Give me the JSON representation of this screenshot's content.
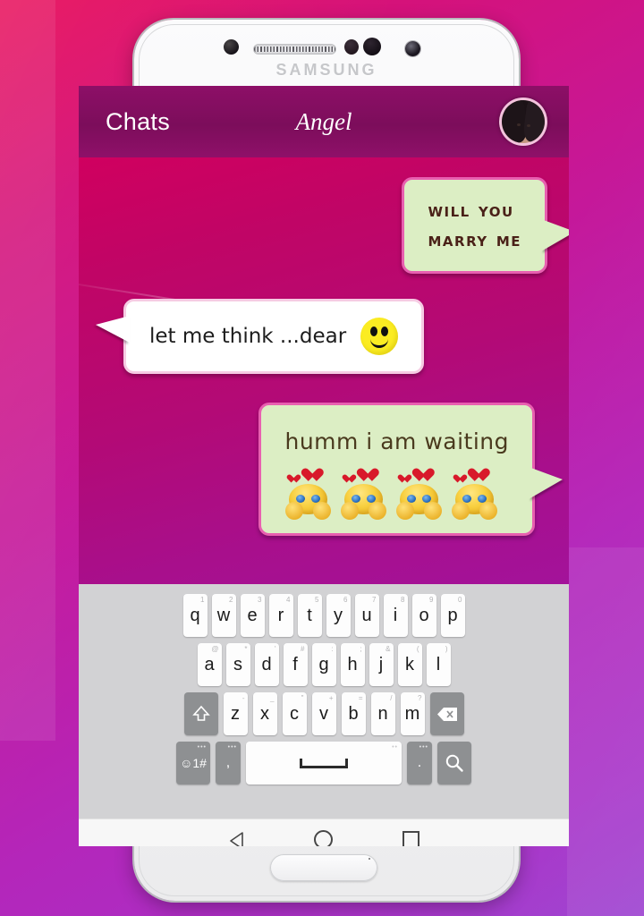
{
  "device": {
    "brand_label": "SAMSUNG",
    "frame_color": "#f2f2f4"
  },
  "app": {
    "header": {
      "left_label": "Chats",
      "title": "Angel",
      "avatar_name": "contact-avatar",
      "background_color": "#7c0d5b"
    },
    "chat": {
      "background_color": "#b30a76",
      "messages": [
        {
          "id": "msg-1",
          "side": "right",
          "text": "will you\nmarry me",
          "bubble_color": "#dceec4",
          "border_color": "#e85fb0",
          "text_color": "#4a2118",
          "emoji": []
        },
        {
          "id": "msg-2",
          "side": "left",
          "text": "let me think ...dear",
          "bubble_color": "#ffffff",
          "border_color": "#f6cbe3",
          "text_color": "#1d1d1d",
          "emoji": [
            "smiley-face-emoji"
          ]
        },
        {
          "id": "msg-3",
          "side": "right",
          "text": "humm i am waiting",
          "bubble_color": "#dceec4",
          "border_color": "#e85fb0",
          "text_color": "#4a3a1e",
          "emoji": [
            "shy-love-emoji",
            "shy-love-emoji",
            "shy-love-emoji",
            "shy-love-emoji"
          ]
        }
      ]
    }
  },
  "keyboard": {
    "background_color": "#d2d2d4",
    "rows": [
      {
        "id": "row-1",
        "keys": [
          {
            "label": "q",
            "sup": "1"
          },
          {
            "label": "w",
            "sup": "2"
          },
          {
            "label": "e",
            "sup": "3"
          },
          {
            "label": "r",
            "sup": "4"
          },
          {
            "label": "t",
            "sup": "5"
          },
          {
            "label": "y",
            "sup": "6"
          },
          {
            "label": "u",
            "sup": "7"
          },
          {
            "label": "i",
            "sup": "8"
          },
          {
            "label": "o",
            "sup": "9"
          },
          {
            "label": "p",
            "sup": "0"
          }
        ]
      },
      {
        "id": "row-2",
        "keys": [
          {
            "label": "a",
            "sup": "@"
          },
          {
            "label": "s",
            "sup": "*"
          },
          {
            "label": "d",
            "sup": "'"
          },
          {
            "label": "f",
            "sup": "#"
          },
          {
            "label": "g",
            "sup": ":"
          },
          {
            "label": "h",
            "sup": ";"
          },
          {
            "label": "j",
            "sup": "&"
          },
          {
            "label": "k",
            "sup": "("
          },
          {
            "label": "l",
            "sup": ")"
          }
        ]
      },
      {
        "id": "row-3",
        "shift_key": "shift-key",
        "backspace_key": "backspace-key",
        "keys": [
          {
            "label": "z",
            "sup": "-"
          },
          {
            "label": "x",
            "sup": "_"
          },
          {
            "label": "c",
            "sup": "\""
          },
          {
            "label": "v",
            "sup": "+"
          },
          {
            "label": "b",
            "sup": "="
          },
          {
            "label": "n",
            "sup": "/"
          },
          {
            "label": "m",
            "sup": "?"
          }
        ]
      },
      {
        "id": "row-4",
        "symbol_key_label": "☺1#",
        "comma_key_label": ",",
        "space_key_label": "",
        "period_key_label": ".",
        "search_key_label": "search-icon"
      }
    ]
  },
  "navbar": {
    "back_label": "back-button",
    "home_label": "home-button",
    "recents_label": "recents-button",
    "background_color": "#f7f7f7"
  },
  "wallpaper": {
    "gradient_start": "#e8115c",
    "gradient_end": "#9b3fd0"
  }
}
